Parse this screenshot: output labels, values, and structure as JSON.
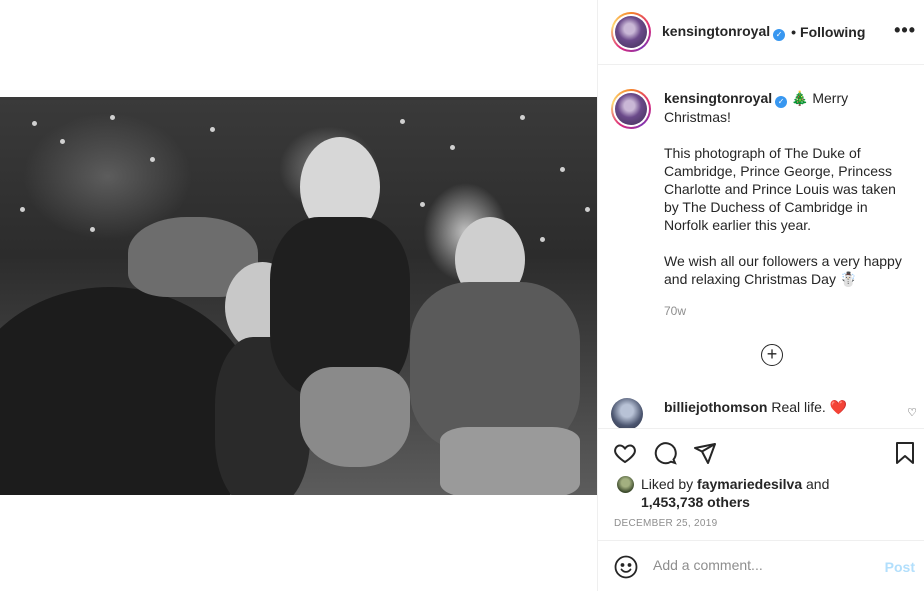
{
  "post": {
    "username": "kensingtonroyal",
    "verified_mark": "✓",
    "separator": "•",
    "follow_status": "Following",
    "more_options": "•••",
    "caption": {
      "username": "kensingtonroyal",
      "line1": " 🎄 Merry Christmas!",
      "body": "This photograph of The Duke of Cambridge, Prince George, Princess Charlotte and Prince Louis was taken by The Duchess of Cambridge in Norfolk earlier this year.",
      "closing": "We wish all our followers a very happy and relaxing Christmas Day ☃️"
    },
    "age": "70w",
    "load_more": "+",
    "comment": {
      "username": "billiejothomson",
      "text": "Real life. ❤️"
    },
    "likes": {
      "prefix": "Liked by ",
      "user": "faymariedesilva",
      "conjunction": " and",
      "count": "1,453,738 others"
    },
    "date": "DECEMBER 25, 2019",
    "add_comment_placeholder": "Add a comment...",
    "post_button": "Post"
  },
  "colors": {
    "verified": "#3897f0",
    "secondary_text": "#8e8e8e",
    "post_button_disabled": "#b2dffc",
    "border": "#efefef"
  },
  "icons": [
    "more-options-icon",
    "heart-icon",
    "comment-icon",
    "share-icon",
    "bookmark-icon",
    "emoji-icon",
    "add-circle-icon",
    "small-heart-icon"
  ]
}
